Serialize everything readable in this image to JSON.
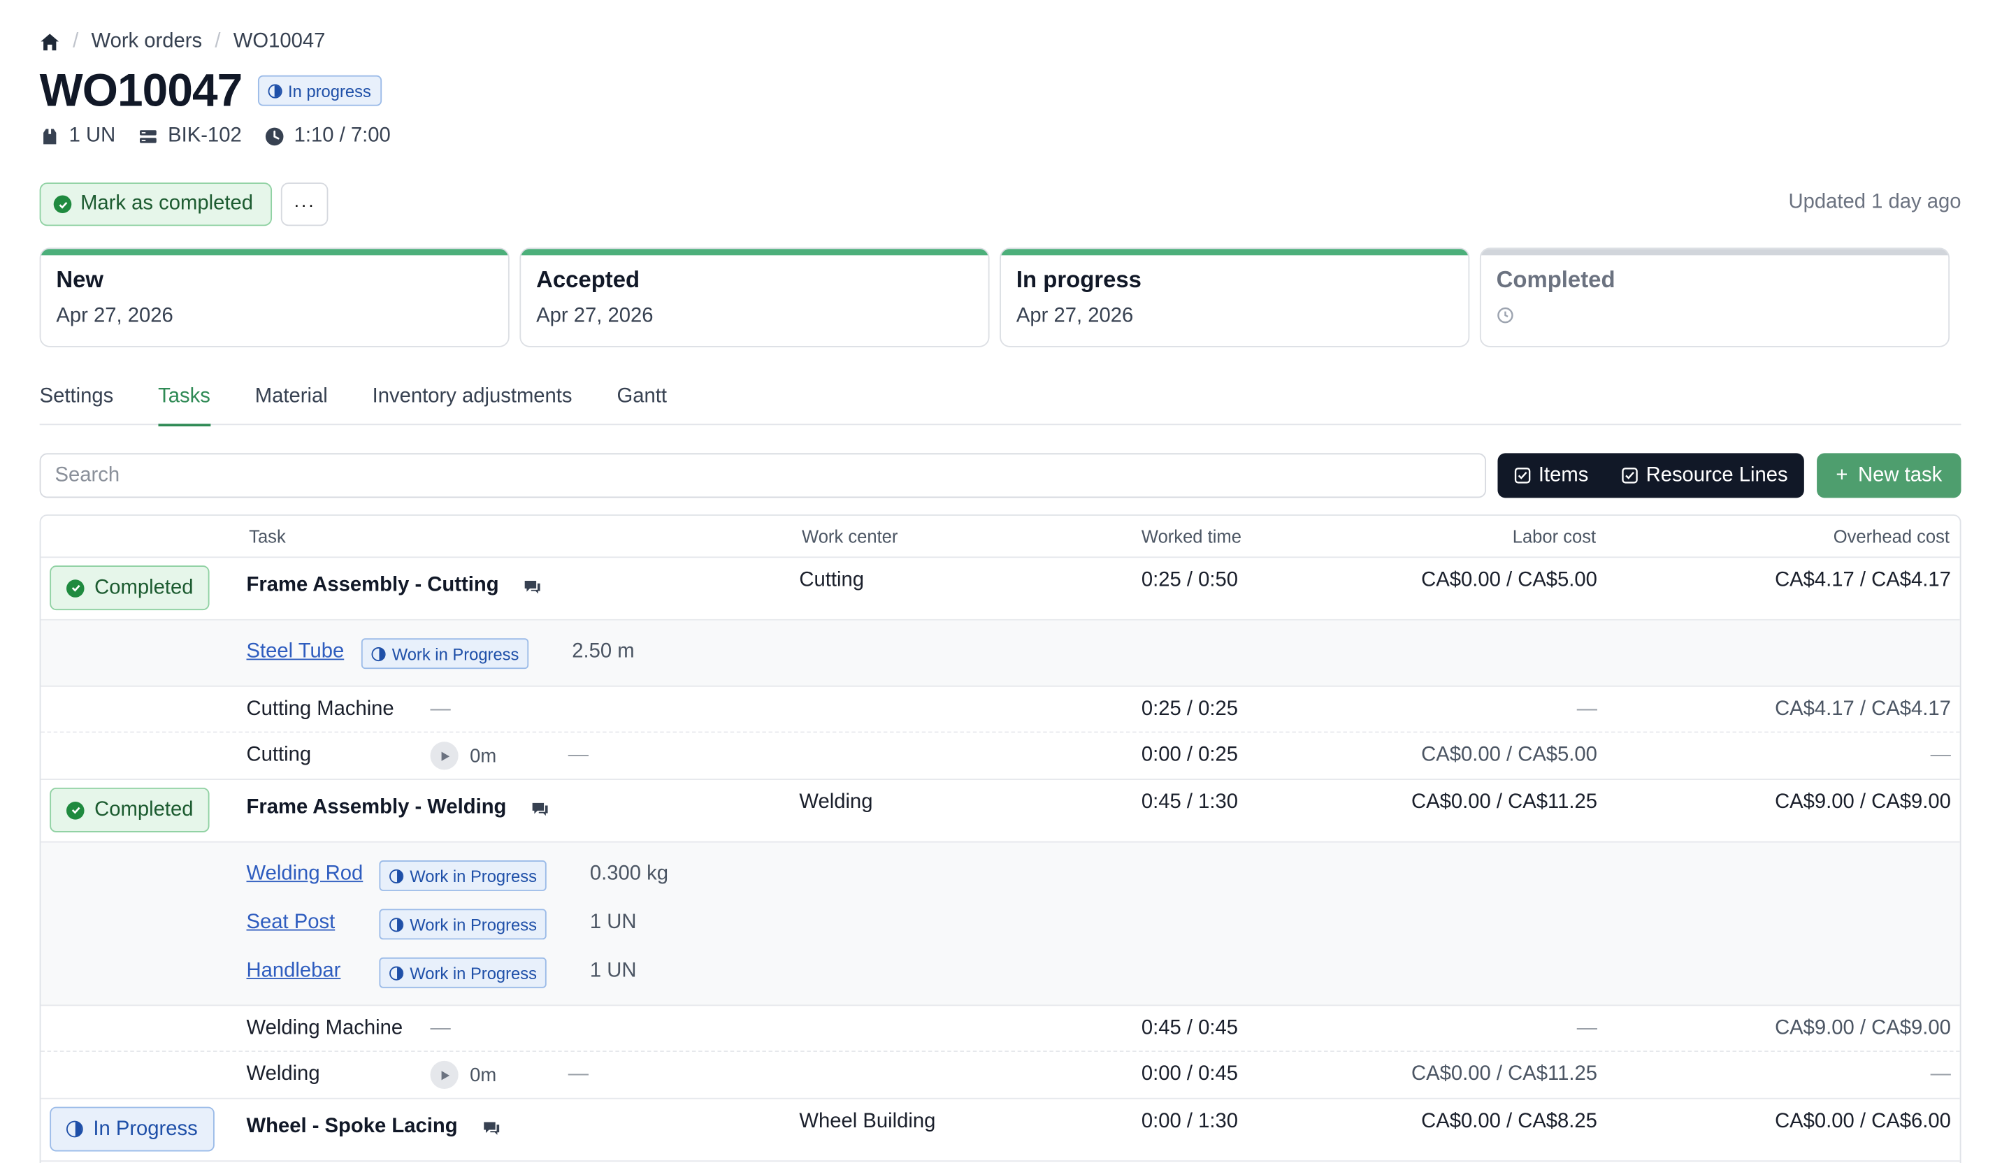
{
  "breadcrumb": {
    "home_icon": "home-icon",
    "items": [
      "Work orders",
      "WO10047"
    ]
  },
  "header": {
    "title": "WO10047",
    "status": "In progress"
  },
  "meta": {
    "quantity": "1 UN",
    "item": "BIK-102",
    "time": "1:10 / 7:00"
  },
  "actions": {
    "complete_label": "Mark as completed",
    "more_label": "···",
    "updated": "Updated 1 day ago"
  },
  "steps": [
    {
      "title": "New",
      "date": "Apr 27, 2026"
    },
    {
      "title": "Accepted",
      "date": "Apr 27, 2026"
    },
    {
      "title": "In progress",
      "date": "Apr 27, 2026"
    },
    {
      "title": "Completed",
      "date": ""
    }
  ],
  "tabs": [
    "Settings",
    "Tasks",
    "Material",
    "Inventory adjustments",
    "Gantt"
  ],
  "active_tab": "Tasks",
  "toolbar": {
    "search_placeholder": "Search",
    "items_label": "Items",
    "resource_label": "Resource Lines",
    "new_task_label": "New task"
  },
  "table": {
    "headers": [
      "Task",
      "Work center",
      "Worked time",
      "Labor cost",
      "Overhead cost"
    ],
    "tasks": [
      {
        "status": "Completed",
        "name": "Frame Assembly - Cutting",
        "work_center": "Cutting",
        "worked": "0:25 / 0:50",
        "labor": "CA$0.00 / CA$5.00",
        "overhead": "CA$4.17 / CA$4.17",
        "materials": [
          {
            "name": "Steel Tube",
            "status": "Work in Progress",
            "qty": "2.50 m"
          }
        ],
        "machine": {
          "name": "Cutting Machine",
          "dash": "—",
          "worked": "0:25 / 0:25",
          "labor": "—",
          "overhead": "CA$4.17 / CA$4.17"
        },
        "labor_line": {
          "name": "Cutting",
          "timer": "0m",
          "dash": "—",
          "worked": "0:00 / 0:25",
          "labor": "CA$0.00 / CA$5.00",
          "overhead": "—"
        }
      },
      {
        "status": "Completed",
        "name": "Frame Assembly - Welding",
        "work_center": "Welding",
        "worked": "0:45 / 1:30",
        "labor": "CA$0.00 / CA$11.25",
        "overhead": "CA$9.00 / CA$9.00",
        "materials": [
          {
            "name": "Welding Rod",
            "status": "Work in Progress",
            "qty": "0.300 kg"
          },
          {
            "name": "Seat Post",
            "status": "Work in Progress",
            "qty": "1 UN"
          },
          {
            "name": "Handlebar",
            "status": "Work in Progress",
            "qty": "1 UN"
          }
        ],
        "machine": {
          "name": "Welding Machine",
          "dash": "—",
          "worked": "0:45 / 0:45",
          "labor": "—",
          "overhead": "CA$9.00 / CA$9.00"
        },
        "labor_line": {
          "name": "Welding",
          "timer": "0m",
          "dash": "—",
          "worked": "0:00 / 0:45",
          "labor": "CA$0.00 / CA$11.25",
          "overhead": "—"
        }
      },
      {
        "status": "In Progress",
        "name": "Wheel - Spoke Lacing",
        "work_center": "Wheel Building",
        "worked": "0:00 / 1:30",
        "labor": "CA$0.00 / CA$8.25",
        "overhead": "CA$0.00 / CA$6.00"
      }
    ]
  },
  "colors": {
    "accent_green": "#2f8a55",
    "new_task_bg": "#4e9e6e",
    "toggle_bg": "#111827",
    "info_blue": "#1e4fa8"
  }
}
